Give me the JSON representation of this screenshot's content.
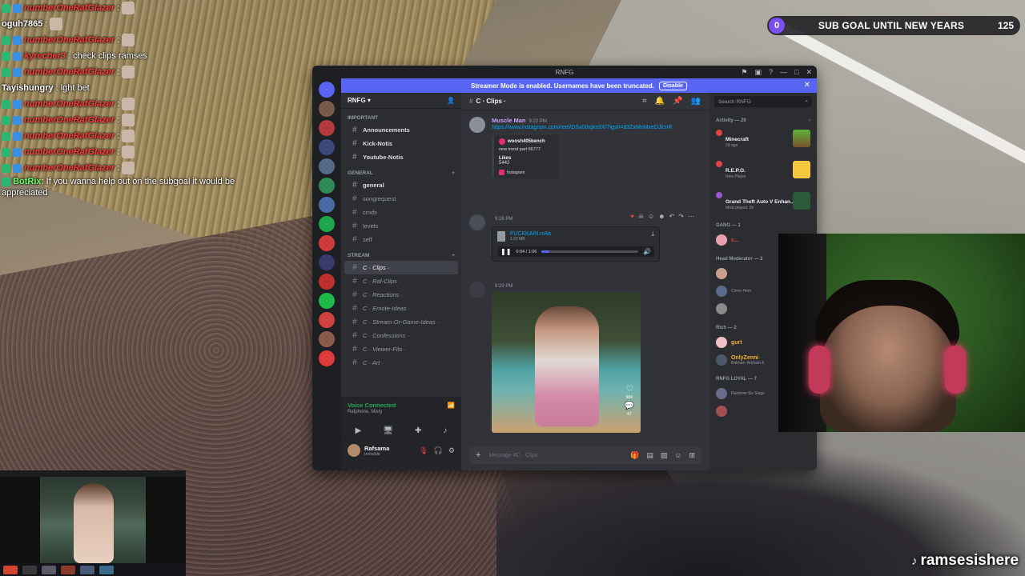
{
  "chat": [
    {
      "user": "numberOneRafGlazer",
      "text": ""
    },
    {
      "user": "oguh7865",
      "text": ""
    },
    {
      "user": "numberOneRafGlazer",
      "text": ""
    },
    {
      "user": "kyrecher3",
      "text": "check clips ramses"
    },
    {
      "user": "numberOneRafGlazer",
      "text": ""
    },
    {
      "user": "Tayishungry",
      "text": "lght bet"
    },
    {
      "user": "numberOneRafGlazer",
      "text": ""
    },
    {
      "user": "numberOneRafGlazer",
      "text": ""
    },
    {
      "user": "numberOneRafGlazer",
      "text": ""
    },
    {
      "user": "numberOneRafGlazer",
      "text": ""
    },
    {
      "user": "numberOneRafGlazer",
      "text": ""
    },
    {
      "user": "BotRix",
      "text": "If you wanna help out on the subgoal it would be appreciated"
    }
  ],
  "subgoal": {
    "current": "0",
    "title": "SUB GOAL UNTIL NEW YEARS",
    "target": "125"
  },
  "discord": {
    "window_title": "RNFG",
    "streamer_mode": {
      "text": "Streamer Mode is enabled. Usernames have been truncated.",
      "button": "Disable"
    },
    "server_name": "RNFG",
    "categories": {
      "important": "Important",
      "general": "GENERAL",
      "stream": "Stream"
    },
    "channels_important": [
      "Announcements",
      "Kick-Notis",
      "Youtube-Notis"
    ],
    "channels_general": [
      "general",
      "songrequest",
      "cmds",
      "levels",
      "self"
    ],
    "channels_stream": [
      "C · Clips ·",
      "C · Raf-Clips ·",
      "C · Reactions ·",
      "C · Emote-Ideas ·",
      "C · Stream-Or-Game-Ideas ·",
      "C · Confessions ·",
      "C · Viewer-Fits ·",
      "C · Art ·"
    ],
    "voice": {
      "status": "Voice Connected",
      "channel": "Rafphone, Misty"
    },
    "me": {
      "name": "Rafsama",
      "status": "Invisible"
    },
    "channel_header": "C · Clips ·",
    "messages": {
      "first": {
        "author": "Muscle Man",
        "time": "9:22 PM",
        "link": "https://www.instagram.com/reel/DSx0Ihqks9X/?igsh=d3ZxMnMxeDJlcnR",
        "embed": {
          "author": "woosh405bench",
          "desc": "new trend part 66777",
          "field_name": "Likes",
          "field_value": "5442",
          "footer": "Instagram"
        }
      },
      "second": {
        "time": "9:26 PM",
        "file_name": "FUCKKARI.m4a",
        "file_size": "1.02 MB",
        "audio_time": "0:04 / 1:06",
        "progress": 0.08
      },
      "third": {
        "time": "9:29 PM",
        "likes": "984",
        "comments": "47"
      }
    },
    "composer_placeholder": "Message #C · Clips ·",
    "search_placeholder": "Search RNFG",
    "activity": {
      "header": "Activity — 29",
      "items": [
        {
          "title": "Minecraft",
          "sub": "2d ago"
        },
        {
          "title": "R.E.P.O.",
          "sub": "New Player"
        },
        {
          "title": "Grand Theft Auto V Enhan...",
          "sub": "Most played: 6h"
        }
      ]
    },
    "groups": [
      {
        "header": "GANG — 1",
        "members": [
          {
            "name": "c...",
            "sub": ""
          }
        ]
      },
      {
        "header": "Head Moderator — 3",
        "members": [
          {
            "name": "",
            "sub": ""
          },
          {
            "name": "",
            "sub": "Clone Hero"
          },
          {
            "name": "",
            "sub": ""
          }
        ]
      },
      {
        "header": "Rich — 2",
        "members": [
          {
            "name": "gurt",
            "sub": ""
          },
          {
            "name": "OnlyZenni",
            "sub": "Batman: Arkham K"
          }
        ]
      },
      {
        "header": "RNFG LOYAL — 7",
        "members": [
          {
            "name": "",
            "sub": "Rainbow Six Siege"
          },
          {
            "name": "",
            "sub": ""
          },
          {
            "name": "",
            "sub": ""
          },
          {
            "name": "",
            "sub": ""
          }
        ]
      }
    ]
  },
  "watermark": "ramsesishere"
}
